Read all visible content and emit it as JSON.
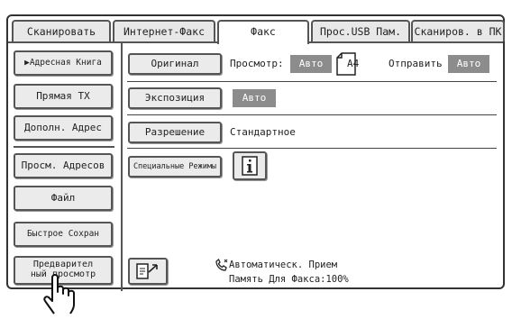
{
  "tabs": [
    {
      "label": "Сканировать",
      "active": false
    },
    {
      "label": "Интернет-Факс",
      "active": false
    },
    {
      "label": "Факс",
      "active": true
    },
    {
      "label": "Прос.USB Пам.",
      "active": false
    },
    {
      "label": "Сканиров. в ПК",
      "active": false
    }
  ],
  "sidebar": {
    "address_book": "Адресная Книга",
    "direct_tx": "Прямая TX",
    "add_address": "Дополн. Адрес",
    "view_addresses": "Просм. Адресов",
    "file": "Файл",
    "quick_save": "Быстрое Сохран",
    "preview_line1": "Предварител",
    "preview_line2": "ный просмотр"
  },
  "main": {
    "original_button": "Оригинал",
    "preview_label": "Просмотр:",
    "preview_value": "Авто",
    "paper_size": "A4",
    "send_label": "Отправить",
    "send_value": "Авто",
    "exposure_button": "Экспозиция",
    "exposure_value": "Авто",
    "resolution_button": "Разрешение",
    "resolution_value": "Стандартное",
    "special_modes_button": "Специальные Режимы"
  },
  "status": {
    "receive_mode": "Автоматическ. Прием",
    "fax_memory": "Память Для Факса:100%"
  },
  "icons": {
    "info": "info-icon",
    "phone": "phone-icon",
    "paper": "paper-a4-icon",
    "send_screen": "send-screen-icon",
    "hand": "pointing-hand-icon"
  }
}
